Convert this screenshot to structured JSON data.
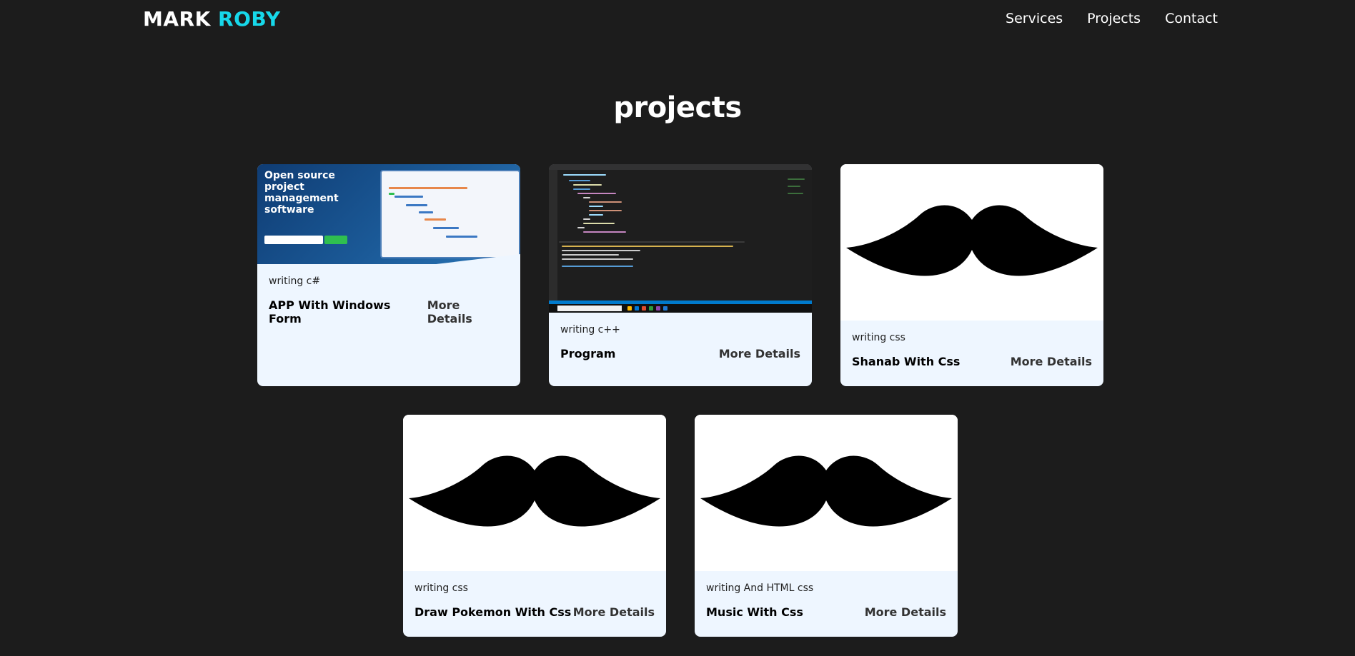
{
  "header": {
    "logo_first": "MARK",
    "logo_second": "ROBY",
    "nav": [
      "Services",
      "Projects",
      "Contact"
    ]
  },
  "projects": {
    "title": "projects",
    "cards": [
      {
        "tag": "writing c#",
        "title": "APP With Windows Form",
        "more": "More Details",
        "image": {
          "kind": "screenshot-pm-software",
          "headline": "Open source project management software"
        }
      },
      {
        "tag": "writing c++",
        "title": "Program",
        "more": "More Details",
        "image": {
          "kind": "screenshot-code-editor"
        }
      },
      {
        "tag": "writing css",
        "title": "Shanab With Css",
        "more": "More Details",
        "image": {
          "kind": "moustache"
        }
      },
      {
        "tag": "writing css",
        "title": "Draw Pokemon With Css",
        "more": "More Details",
        "image": {
          "kind": "moustache"
        }
      },
      {
        "tag": "writing And HTML css",
        "title": "Music With Css",
        "more": "More Details",
        "image": {
          "kind": "moustache"
        }
      }
    ]
  },
  "colors": {
    "background": "#1c1c1c",
    "accent": "#17d8ea",
    "card": "#eef6ff"
  }
}
